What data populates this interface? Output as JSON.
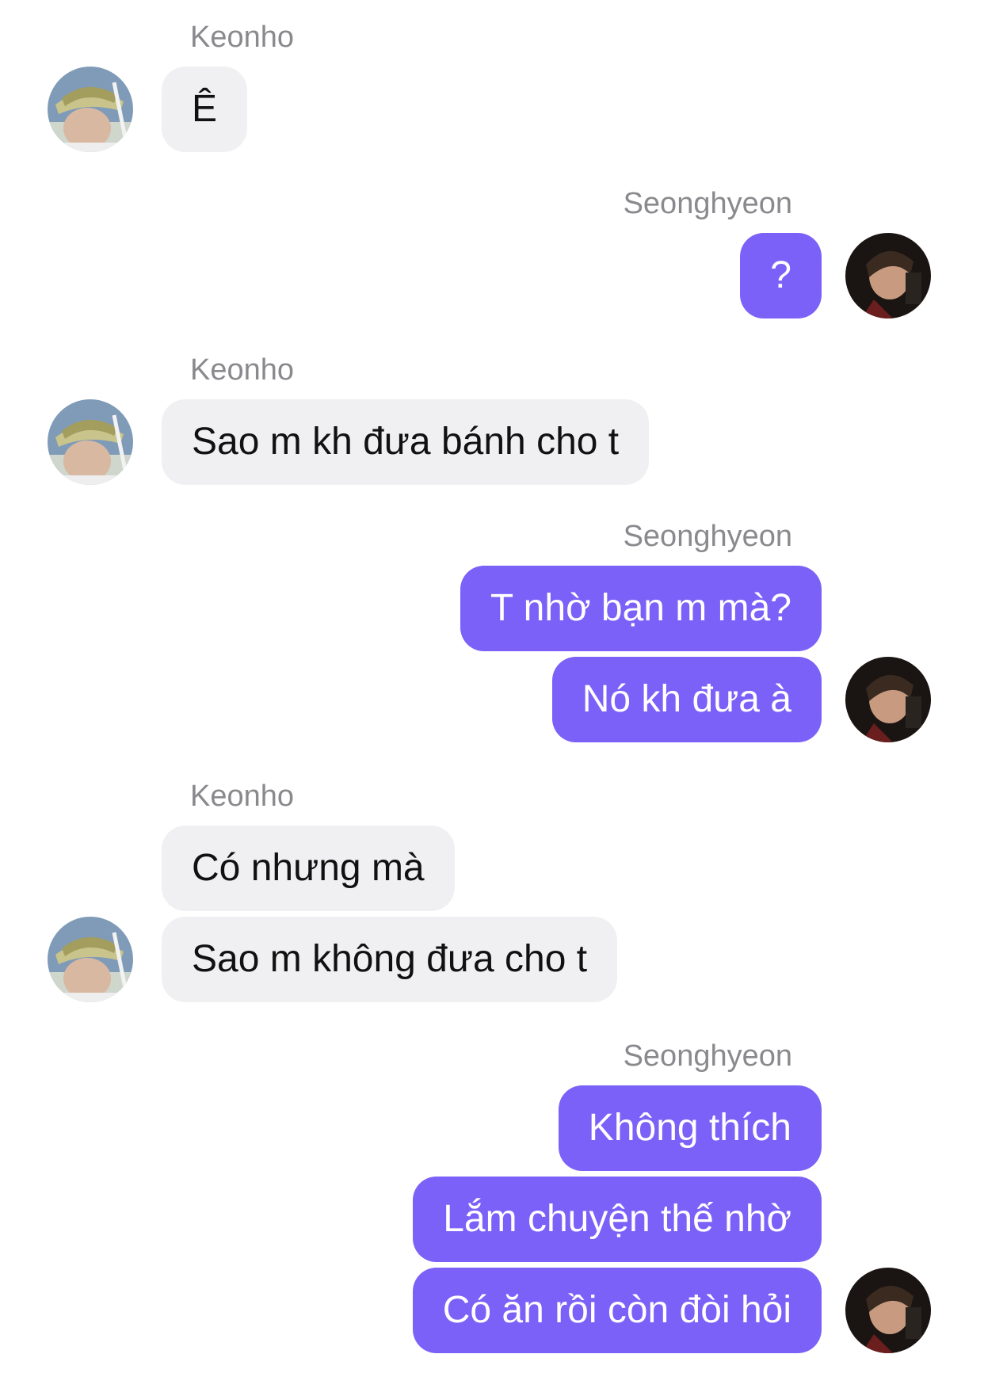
{
  "conversation": {
    "participants": {
      "left": "Keonho",
      "right": "Seonghyeon"
    },
    "colors": {
      "incoming_bubble": "#f0f0f2",
      "outgoing_bubble": "#7b61f8",
      "sender_name": "#8a8a8e"
    },
    "groups": [
      {
        "sender": "Keonho",
        "messages": [
          "Ê"
        ]
      },
      {
        "sender": "Seonghyeon",
        "messages": [
          "?"
        ]
      },
      {
        "sender": "Keonho",
        "messages": [
          "Sao m kh đưa bánh cho t"
        ]
      },
      {
        "sender": "Seonghyeon",
        "messages": [
          "T nhờ bạn m mà?",
          "Nó kh đưa à"
        ]
      },
      {
        "sender": "Keonho",
        "messages": [
          "Có nhưng mà",
          "Sao m không đưa cho t"
        ]
      },
      {
        "sender": "Seonghyeon",
        "messages": [
          "Không thích",
          "Lắm chuyện thế nhờ",
          "Có ăn rồi còn đòi hỏi"
        ]
      }
    ]
  }
}
